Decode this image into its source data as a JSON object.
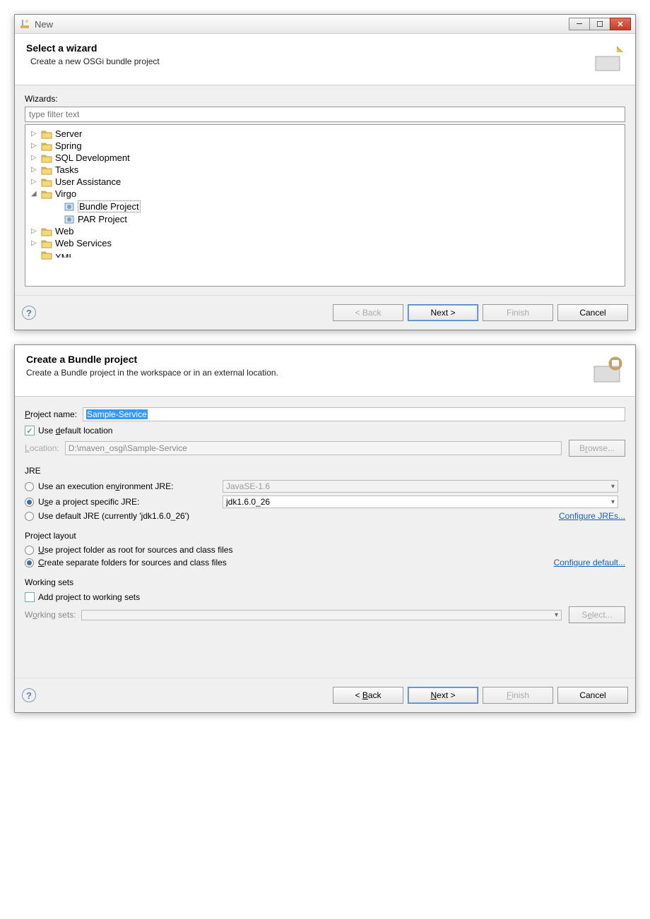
{
  "dialog1": {
    "window_title": "New",
    "title": "Select a wizard",
    "subtitle": "Create a new OSGi bundle project",
    "wizards_label": "Wizards:",
    "filter_placeholder": "type filter text",
    "tree": [
      {
        "expander": "▷",
        "label": "Server",
        "icon": "folder"
      },
      {
        "expander": "▷",
        "label": "Spring",
        "icon": "folder"
      },
      {
        "expander": "▷",
        "label": "SQL Development",
        "icon": "folder"
      },
      {
        "expander": "▷",
        "label": "Tasks",
        "icon": "folder"
      },
      {
        "expander": "▷",
        "label": "User Assistance",
        "icon": "folder"
      },
      {
        "expander": "◢",
        "label": "Virgo",
        "icon": "folder"
      },
      {
        "expander": "",
        "label": "Bundle Project",
        "icon": "bundle",
        "indent": 1,
        "selected": true
      },
      {
        "expander": "",
        "label": "PAR Project",
        "icon": "par",
        "indent": 1
      },
      {
        "expander": "▷",
        "label": "Web",
        "icon": "folder"
      },
      {
        "expander": "▷",
        "label": "Web Services",
        "icon": "folder"
      },
      {
        "expander": "",
        "label": "XML",
        "icon": "folder",
        "cut": true
      }
    ],
    "buttons": {
      "back": "< Back",
      "next": "Next >",
      "finish": "Finish",
      "cancel": "Cancel"
    }
  },
  "dialog2": {
    "title": "Create a Bundle project",
    "subtitle": "Create a Bundle project in the workspace or in an external location.",
    "project_name_label": "Project name:",
    "project_name_value": "Sample-Service",
    "use_default_label": "Use default location",
    "location_label": "Location:",
    "location_value": "D:\\maven_osgi\\Sample-Service",
    "browse_btn": "Browse...",
    "jre_title": "JRE",
    "jre_exec_env": "Use an execution environment JRE:",
    "jre_exec_env_val": "JavaSE-1.6",
    "jre_project": "Use a project specific JRE:",
    "jre_project_val": "jdk1.6.0_26",
    "jre_default": "Use default JRE (currently 'jdk1.6.0_26')",
    "configure_jres": "Configure JREs...",
    "layout_title": "Project layout",
    "layout_opt1": "Use project folder as root for sources and class files",
    "layout_opt2": "Create separate folders for sources and class files",
    "configure_default": "Configure default...",
    "ws_title": "Working sets",
    "ws_add": "Add project to working sets",
    "ws_label": "Working sets:",
    "select_btn": "Select...",
    "buttons": {
      "back": "< Back",
      "next": "Next >",
      "finish": "Finish",
      "cancel": "Cancel"
    }
  }
}
